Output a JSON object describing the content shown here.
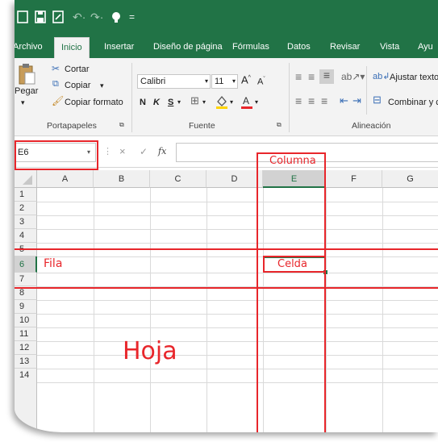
{
  "quick_access": {
    "save_icon": "save-icon",
    "undo_icon": "undo-icon",
    "redo_icon": "redo-icon"
  },
  "tabs": [
    {
      "label": "Archivo"
    },
    {
      "label": "Inicio"
    },
    {
      "label": "Insertar"
    },
    {
      "label": "Diseño de página"
    },
    {
      "label": "Fórmulas"
    },
    {
      "label": "Datos"
    },
    {
      "label": "Revisar"
    },
    {
      "label": "Vista"
    },
    {
      "label": "Ayu"
    }
  ],
  "clipboard": {
    "paste": "Pegar",
    "cut": "Cortar",
    "copy": "Copiar",
    "format_painter": "Copiar formato",
    "group": "Portapapeles"
  },
  "font": {
    "name": "Calibri",
    "size": "11",
    "bold": "N",
    "italic": "K",
    "underline": "S",
    "group": "Fuente"
  },
  "alignment": {
    "wrap": "Ajustar texto",
    "merge": "Combinar y c",
    "group": "Alineación"
  },
  "formula_bar": {
    "name_box": "E6",
    "fx": "fx",
    "cancel": "×",
    "enter": "✓",
    "value": ""
  },
  "columns": [
    "A",
    "B",
    "C",
    "D",
    "E",
    "F",
    "G"
  ],
  "rows": [
    "1",
    "2",
    "3",
    "4",
    "5",
    "6",
    "7",
    "8",
    "9",
    "10",
    "11",
    "12",
    "13",
    "14"
  ],
  "annotations": {
    "column": "Columna",
    "row": "Fila",
    "cell": "Celda",
    "sheet": "Hoja"
  },
  "colors": {
    "excel_green": "#217346",
    "annotation_red": "#e8262b",
    "selected_cell": "#217346"
  }
}
